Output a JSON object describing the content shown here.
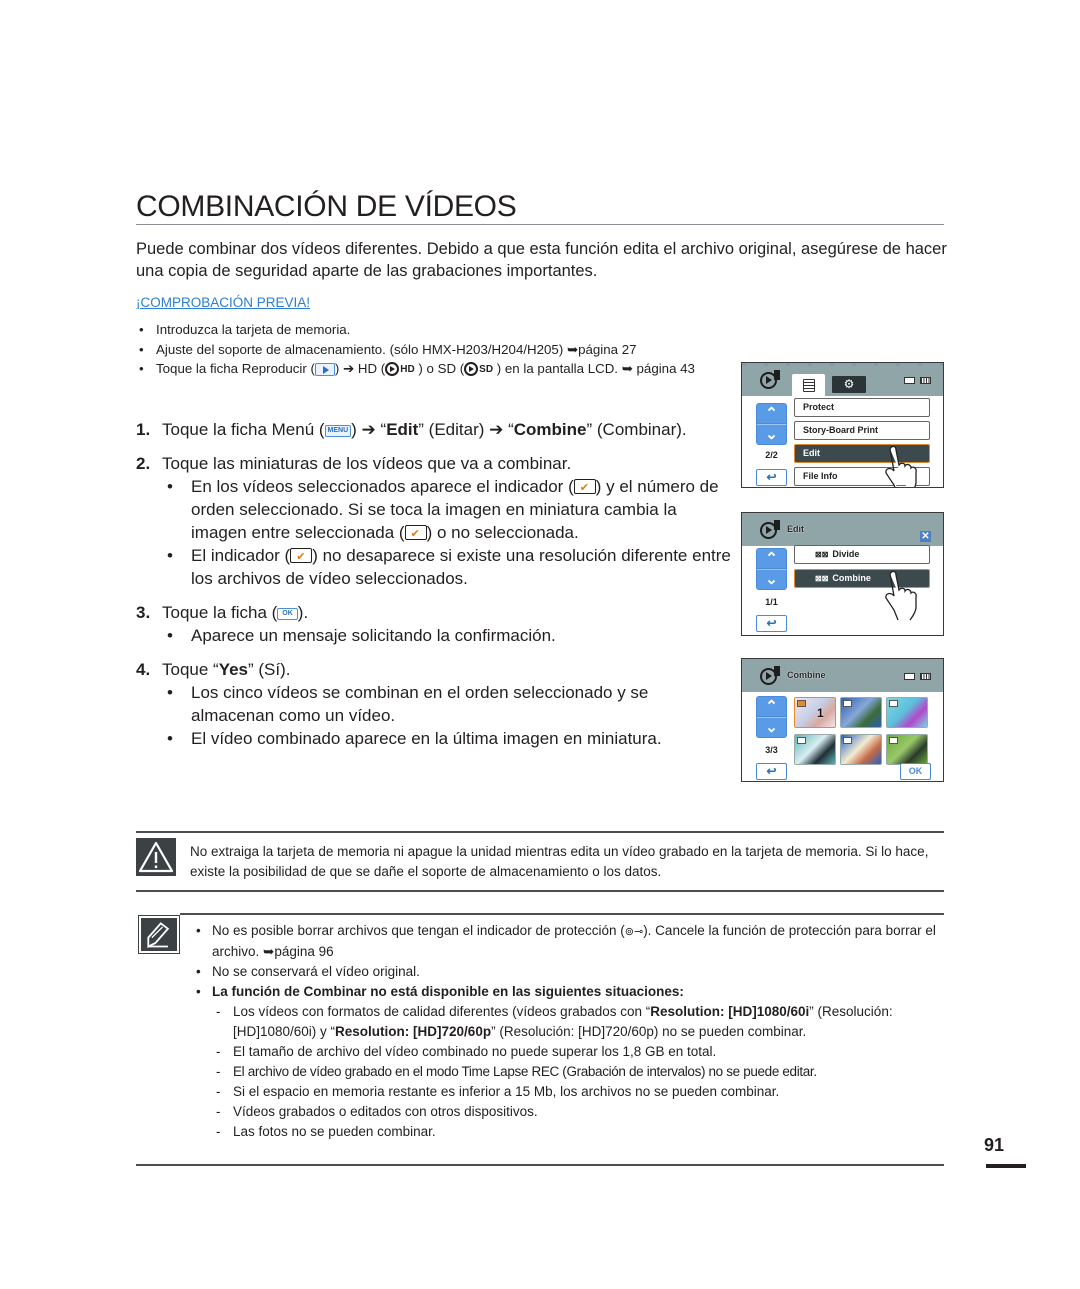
{
  "title": "COMBINACIÓN DE VÍDEOS",
  "intro": "Puede combinar dos vídeos diferentes. Debido a que esta función edita el archivo original, asegúrese de hacer una copia de seguridad aparte de las grabaciones importantes.",
  "precheck": {
    "heading": "¡COMPROBACIÓN PREVIA!",
    "items": [
      {
        "text": "Introduzca la tarjeta de memoria."
      },
      {
        "text": "Ajuste del soporte de almacenamiento. (sólo HMX-H203/H204/H205) ",
        "ref_arrow": "➥",
        "ref": "página 27"
      },
      {
        "pre": "Toque la ficha Reproducir (",
        "mid1": ") ➔ HD (",
        "hd": "HD",
        "mid2": " ) o SD (",
        "sd": "SD",
        "post": " ) en la pantalla LCD. ",
        "ref_arrow": "➥",
        "ref": " página 43"
      }
    ]
  },
  "icons": {
    "menu_label": "MENU",
    "ok_label": "OK",
    "arrow": "➔"
  },
  "steps": [
    {
      "num": "1.",
      "parts": {
        "a": "Toque la ficha Menú (",
        "b": ") ➔ “",
        "edit": "Edit",
        "c": "” (Editar) ➔ “",
        "combine": "Combine",
        "d": "” (Combinar)."
      }
    },
    {
      "num": "2.",
      "text": "Toque las miniaturas de los vídeos que va a combinar.",
      "bullets": [
        {
          "a": "En los vídeos seleccionados aparece el indicador (",
          "b": ") y el número de orden seleccionado. Si se toca la imagen en miniatura cambia la imagen entre seleccionada (",
          "c": ") o no seleccionada."
        },
        {
          "a": "El indicador (",
          "b": ") no desaparece si existe una resolución diferente entre los archivos de vídeo seleccionados."
        }
      ]
    },
    {
      "num": "3.",
      "a": "Toque la ficha (",
      "b": ").",
      "bullets": [
        {
          "text": "Aparece un mensaje solicitando la confirmación."
        }
      ]
    },
    {
      "num": "4.",
      "a": "Toque “",
      "yes": "Yes",
      "b": "” (Sí).",
      "bullets": [
        {
          "text": "Los cinco vídeos se combinan en el orden seleccionado y se almacenan como un vídeo."
        },
        {
          "text": "El vídeo combinado aparece en la última imagen en miniatura."
        }
      ]
    }
  ],
  "screen1": {
    "gear": "⚙",
    "menu_items": [
      "Protect",
      "Story-Board Print",
      "Edit",
      "File Info"
    ],
    "selected_index": 2,
    "pager": "2/2",
    "up": "⌃",
    "down": "⌄",
    "back": "↩"
  },
  "screen2": {
    "title": "Edit",
    "close": "✕",
    "menu_items": [
      {
        "sym": "⊠⊠",
        "label": "Divide"
      },
      {
        "sym": "⊠⊠",
        "label": "Combine"
      }
    ],
    "selected_index": 1,
    "pager": "1/1",
    "up": "⌃",
    "down": "⌄",
    "back": "↩"
  },
  "screen3": {
    "title": "Combine",
    "pager": "3/3",
    "up": "⌃",
    "down": "⌄",
    "back": "↩",
    "ok": "OK",
    "thumbs": [
      {
        "selected": true,
        "order": "1",
        "colors": [
          "#f2e6e8",
          "#d9a8a0",
          "#c7d0e8"
        ]
      },
      {
        "selected": false,
        "order": "",
        "colors": [
          "#2d5fae",
          "#3c6b3a",
          "#86a7d8"
        ]
      },
      {
        "selected": false,
        "order": "",
        "colors": [
          "#7fd4e6",
          "#b248c9",
          "#5cc0db"
        ]
      },
      {
        "selected": false,
        "order": "",
        "colors": [
          "#5fb6b7",
          "#1f2e35",
          "#d9eef2"
        ]
      },
      {
        "selected": false,
        "order": "",
        "colors": [
          "#2760c9",
          "#c66a45",
          "#f2ecd0"
        ]
      },
      {
        "selected": false,
        "order": "",
        "colors": [
          "#6aa83a",
          "#2a3a2a",
          "#9ac86a"
        ]
      }
    ]
  },
  "warning": "No extraiga la tarjeta de memoria ni apague la unidad mientras edita un vídeo grabado en la tarjeta de memoria. Si lo hace, existe la posibilidad de que se dañe el soporte de almacenamiento o los datos.",
  "notes": {
    "n1": {
      "a": "No es posible borrar archivos que tengan el indicador de protección (",
      "key": "⊚⊸",
      "b": "). Cancele la función de protección para borrar el archivo. ",
      "arrow": "➥",
      "ref": "página 96"
    },
    "n2": "No se conservará el vídeo original.",
    "n3": "La función de Combinar no está disponible en las siguientes situaciones:",
    "sub1": {
      "a": "Los vídeos con formatos de calidad diferentes (vídeos grabados con “",
      "b1": "Resolution: [HD]1080/60i",
      "c": "” (Resolución: [HD]1080/60i) y “",
      "b2": "Resolution: [HD]720/60p",
      "d": "” (Resolución: [HD]720/60p) no se pueden combinar."
    },
    "sub": [
      "El tamaño de archivo del vídeo combinado no puede superar los 1,8 GB en total.",
      "El archivo de vídeo grabado en el modo Time Lapse REC (Grabación de intervalos) no se puede editar.",
      "Si el espacio en memoria restante es inferior a 15 Mb, los archivos no se pueden combinar.",
      "Vídeos grabados o editados con otros dispositivos.",
      "Las fotos no se pueden combinar."
    ]
  },
  "page_number": "91"
}
